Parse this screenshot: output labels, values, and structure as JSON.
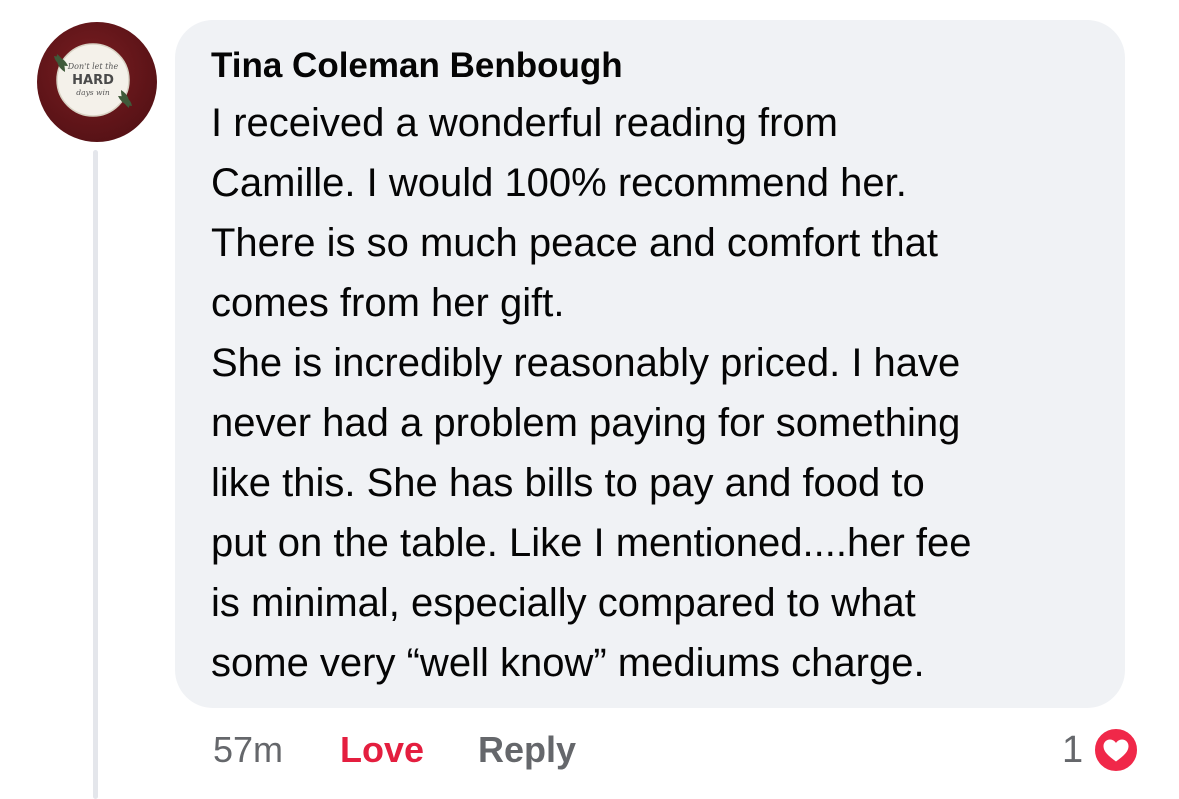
{
  "comment": {
    "author": "Tina Coleman Benbough",
    "avatar_icon": "profile-photo-dont-let-hard-days-win",
    "avatar_text": "Don't let the HARD days win",
    "lines": [
      "I received a wonderful reading from",
      "Camille. I would 100% recommend her.",
      "There is so much peace and comfort that",
      "comes from her gift.",
      "She is incredibly reasonably priced. I have",
      "never had a problem paying for something",
      "like this. She has bills to pay and food to",
      "put on the table. Like I mentioned....her fee",
      "is minimal, especially compared to what",
      "some very “well know” mediums charge."
    ]
  },
  "actions": {
    "timestamp": "57m",
    "love_label": "Love",
    "reply_label": "Reply"
  },
  "reactions": {
    "count": "1",
    "icon": "heart-icon",
    "color": "#f02849"
  },
  "colors": {
    "bubble": "#f0f2f5",
    "love_accent": "#e41e3f",
    "secondary_text": "#65676b"
  }
}
